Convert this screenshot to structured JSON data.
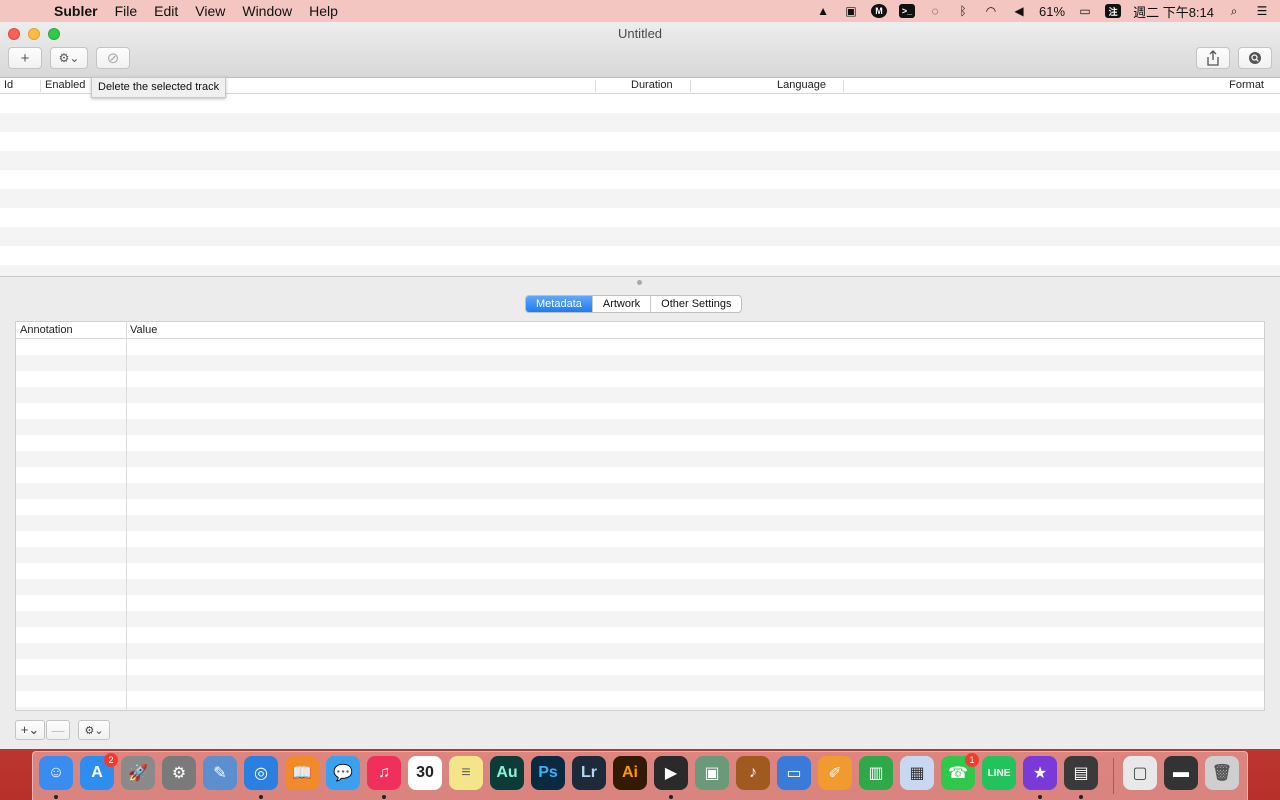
{
  "menubar": {
    "app_name": "Subler",
    "items": [
      "File",
      "Edit",
      "View",
      "Window",
      "Help"
    ],
    "battery": "61%",
    "datetime": "週二 下午8:14",
    "input_method": "注"
  },
  "window": {
    "title": "Untitled"
  },
  "toolbar": {
    "add_label": "+",
    "gear_label": "⚙︎⌄",
    "delete_label": "⊘",
    "tooltip": "Delete the selected track"
  },
  "tracks": {
    "columns": [
      "Id",
      "Enabled",
      "Duration",
      "Language",
      "Format"
    ]
  },
  "tabs": {
    "items": [
      "Metadata",
      "Artwork",
      "Other Settings"
    ],
    "selected": "Metadata"
  },
  "metadata": {
    "columns": [
      "Annotation",
      "Value"
    ]
  },
  "bottom": {
    "add_label": "+⌄",
    "remove_label": "—",
    "gear_label": "⚙︎⌄"
  },
  "dock": {
    "apps": [
      {
        "name": "Finder",
        "glyph": "☺",
        "color": "#3a8df0"
      },
      {
        "name": "App Store",
        "glyph": "A",
        "color": "#2d8ef0",
        "badge": "2"
      },
      {
        "name": "Launchpad",
        "glyph": "🚀",
        "color": "#8a8a8a"
      },
      {
        "name": "System Preferences",
        "glyph": "⚙",
        "color": "#7a7a7a"
      },
      {
        "name": "Preview",
        "glyph": "✎",
        "color": "#5b8fcf"
      },
      {
        "name": "Safari",
        "glyph": "◎",
        "color": "#2b7fe0"
      },
      {
        "name": "iBooks",
        "glyph": "📖",
        "color": "#f08a2a"
      },
      {
        "name": "Messages",
        "glyph": "💬",
        "color": "#3aa0f0"
      },
      {
        "name": "iTunes",
        "glyph": "♫",
        "color": "#f0305a"
      },
      {
        "name": "Calendar",
        "glyph": "30",
        "color": "#ffffff",
        "text": "#222"
      },
      {
        "name": "Notes",
        "glyph": "≡",
        "color": "#f5e58a",
        "text": "#666"
      },
      {
        "name": "Audition",
        "glyph": "Au",
        "color": "#0c3c38",
        "text": "#8ff0d8"
      },
      {
        "name": "Photoshop",
        "glyph": "Ps",
        "color": "#0a2a40",
        "text": "#3bb0ff"
      },
      {
        "name": "Lightroom",
        "glyph": "Lr",
        "color": "#1c2a3a",
        "text": "#b8d6f0"
      },
      {
        "name": "Illustrator",
        "glyph": "Ai",
        "color": "#321a05",
        "text": "#ff9a00"
      },
      {
        "name": "Final Cut Pro",
        "glyph": "▶",
        "color": "#2a2a2a"
      },
      {
        "name": "Image Capture",
        "glyph": "▣",
        "color": "#6a9a7a"
      },
      {
        "name": "GarageBand",
        "glyph": "♪",
        "color": "#a05a20"
      },
      {
        "name": "Keynote",
        "glyph": "▭",
        "color": "#3a7ad8"
      },
      {
        "name": "Pages",
        "glyph": "✐",
        "color": "#f09a30"
      },
      {
        "name": "Numbers",
        "glyph": "▥",
        "color": "#2fa84a"
      },
      {
        "name": "Preview2",
        "glyph": "▦",
        "color": "#c8d8f0",
        "text": "#333"
      },
      {
        "name": "FaceTime",
        "glyph": "☎",
        "color": "#2fc84a",
        "badge": "1"
      },
      {
        "name": "LINE",
        "glyph": "LINE",
        "color": "#22c35a"
      },
      {
        "name": "iMovie",
        "glyph": "★",
        "color": "#7a3ad8"
      },
      {
        "name": "Video Editor",
        "glyph": "▤",
        "color": "#3a3a3a"
      },
      {
        "name": "Downloads",
        "glyph": "▢",
        "color": "#e8e8e8",
        "text": "#444"
      },
      {
        "name": "Screen",
        "glyph": "▬",
        "color": "#333333"
      },
      {
        "name": "Trash",
        "glyph": "🗑",
        "color": "#cfcfcf",
        "text": "#555"
      }
    ]
  }
}
